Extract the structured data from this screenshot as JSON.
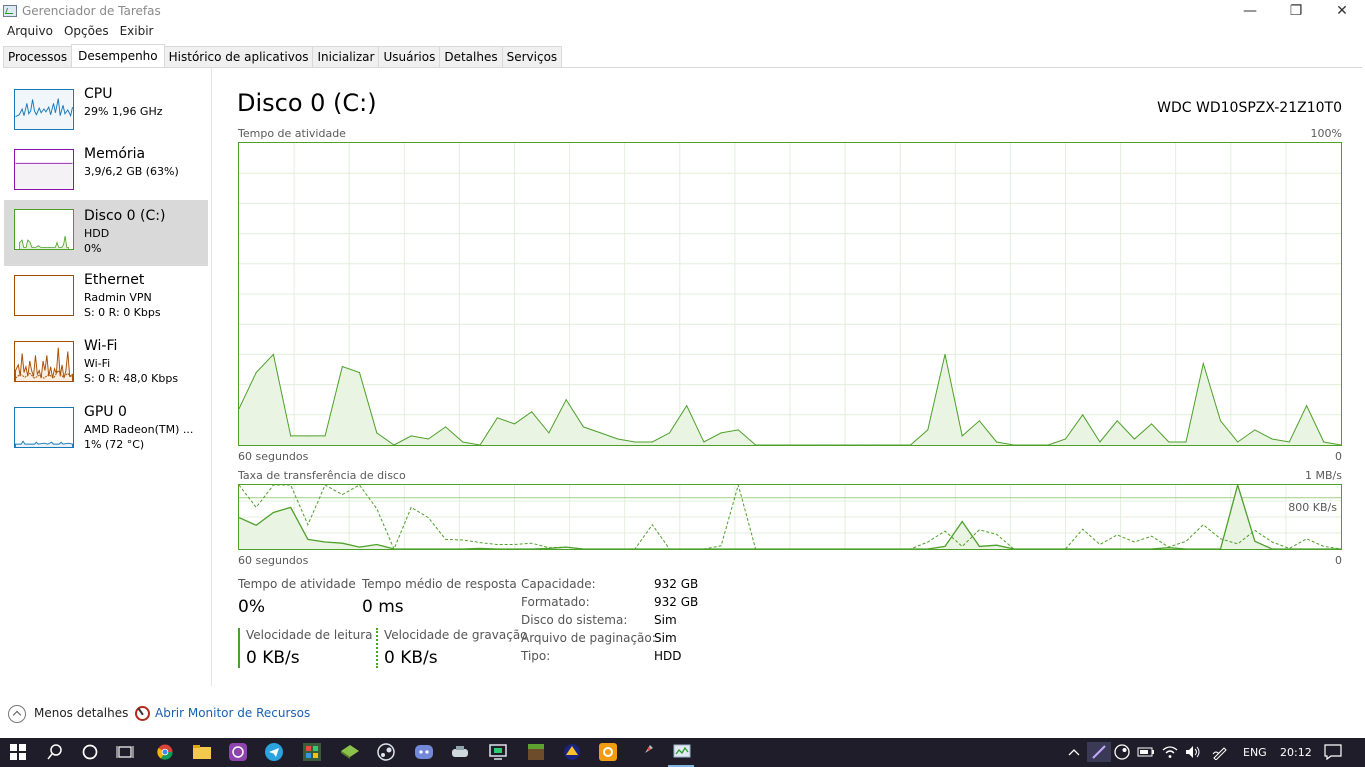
{
  "window": {
    "title": "Gerenciador de Tarefas",
    "min_glyph": "—",
    "max_glyph": "❐",
    "close_glyph": "✕"
  },
  "menu": [
    "Arquivo",
    "Opções",
    "Exibir"
  ],
  "tabs": [
    "Processos",
    "Desempenho",
    "Histórico de aplicativos",
    "Inicializar",
    "Usuários",
    "Detalhes",
    "Serviços"
  ],
  "active_tab": "Desempenho",
  "sidebar": {
    "items": [
      {
        "name": "CPU",
        "line1": "29% 1,96 GHz",
        "line2": "",
        "color": "#1779ba"
      },
      {
        "name": "Memória",
        "line1": "3,9/6,2 GB (63%)",
        "line2": "",
        "color": "#8b12ae"
      },
      {
        "name": "Disco 0 (C:)",
        "line1": "HDD",
        "line2": "0%",
        "color": "#4da02a"
      },
      {
        "name": "Ethernet",
        "line1": "Radmin VPN",
        "line2": "S: 0 R: 0 Kbps",
        "color": "#a74f01"
      },
      {
        "name": "Wi-Fi",
        "line1": "Wi-Fi",
        "line2": "S: 0 R: 48,0 Kbps",
        "color": "#a74f01"
      },
      {
        "name": "GPU 0",
        "line1": "AMD Radeon(TM) ...",
        "line2": "1% (72 °C)",
        "color": "#1779ba"
      }
    ]
  },
  "main": {
    "title": "Disco 0 (C:)",
    "model": "WDC WD10SPZX-21Z10T0",
    "activity_label": "Tempo de atividade",
    "activity_max": "100%",
    "activity_time": "60 segundos",
    "activity_min": "0",
    "transfer_label": "Taxa de transferência de disco",
    "transfer_max": "1 MB/s",
    "transfer_mid": "800 KB/s",
    "transfer_time": "60 segundos",
    "transfer_min": "0",
    "stats": {
      "active_label": "Tempo de atividade",
      "active_value": "0%",
      "response_label": "Tempo médio de resposta",
      "response_value": "0 ms",
      "read_label": "Velocidade de leitura",
      "read_value": "0 KB/s",
      "write_label": "Velocidade de gravação",
      "write_value": "0 KB/s"
    },
    "info": [
      {
        "k": "Capacidade:",
        "v": "932 GB"
      },
      {
        "k": "Formatado:",
        "v": "932 GB"
      },
      {
        "k": "Disco do sistema:",
        "v": "Sim"
      },
      {
        "k": "Arquivo de paginação:",
        "v": "Sim"
      },
      {
        "k": "Tipo:",
        "v": "HDD"
      }
    ]
  },
  "chart_data": [
    {
      "type": "area",
      "title": "Tempo de atividade",
      "ylim": [
        0,
        100
      ],
      "x": [
        0,
        1,
        2,
        3,
        4,
        5,
        6,
        7,
        8,
        9,
        10,
        11,
        12,
        13,
        14,
        15,
        16,
        17,
        18,
        19,
        20,
        21,
        22,
        23,
        24,
        25,
        26,
        27,
        28,
        29,
        30,
        31,
        32,
        33,
        34,
        35,
        36,
        37,
        38,
        39,
        40,
        41,
        42,
        43,
        44,
        45,
        46,
        47,
        48,
        49,
        50,
        51,
        52,
        53,
        54,
        55,
        56,
        57,
        58,
        59,
        60
      ],
      "series": [
        {
          "values": [
            12,
            24,
            30,
            3,
            3,
            3,
            26,
            24,
            4,
            0,
            3,
            2,
            6,
            1,
            0,
            9,
            7,
            11,
            4,
            15,
            6,
            4,
            2,
            1,
            1,
            4,
            13,
            1,
            4,
            5,
            0,
            0,
            0,
            0,
            0,
            0,
            0,
            0,
            0,
            0,
            5,
            30,
            3,
            8,
            1,
            0,
            0,
            0,
            2,
            10,
            1,
            8,
            2,
            7,
            1,
            1,
            27,
            8,
            1,
            5,
            2,
            1,
            13,
            1,
            0
          ]
        }
      ],
      "xlabel": "60 segundos",
      "color": "#4da02a"
    },
    {
      "type": "line",
      "title": "Taxa de transferência de disco",
      "ylim": [
        0,
        1000
      ],
      "series": [
        {
          "values": [
            490,
            370,
            570,
            650,
            150,
            110,
            90,
            30,
            70,
            0,
            0,
            0,
            0,
            0,
            10,
            0,
            0,
            0,
            10,
            30,
            0,
            0,
            0,
            0,
            0,
            0,
            0,
            0,
            0,
            0,
            0,
            0,
            0,
            0,
            0,
            0,
            0,
            0,
            0,
            0,
            0,
            40,
            430,
            40,
            60,
            0,
            0,
            0,
            0,
            0,
            0,
            0,
            0,
            0,
            20,
            0,
            0,
            0,
            1000,
            120,
            0,
            0,
            0,
            0,
            0
          ]
        },
        {
          "values": [
            1000,
            650,
            1000,
            1000,
            380,
            1000,
            850,
            1000,
            630,
            0,
            650,
            490,
            150,
            140,
            100,
            70,
            70,
            90,
            20,
            30,
            0,
            0,
            0,
            0,
            380,
            0,
            0,
            0,
            50,
            1000,
            0,
            0,
            0,
            0,
            0,
            0,
            0,
            0,
            0,
            0,
            110,
            280,
            40,
            300,
            230,
            0,
            0,
            0,
            0,
            310,
            70,
            220,
            110,
            200,
            30,
            120,
            380,
            160,
            80,
            290,
            110,
            10,
            160,
            40,
            0
          ]
        }
      ],
      "xlabel": "60 segundos",
      "color": "#4da02a"
    }
  ],
  "footer": {
    "less": "Menos detalhes",
    "monitor": "Abrir Monitor de Recursos"
  },
  "tray": {
    "lang": "ENG",
    "time": "20:12"
  }
}
